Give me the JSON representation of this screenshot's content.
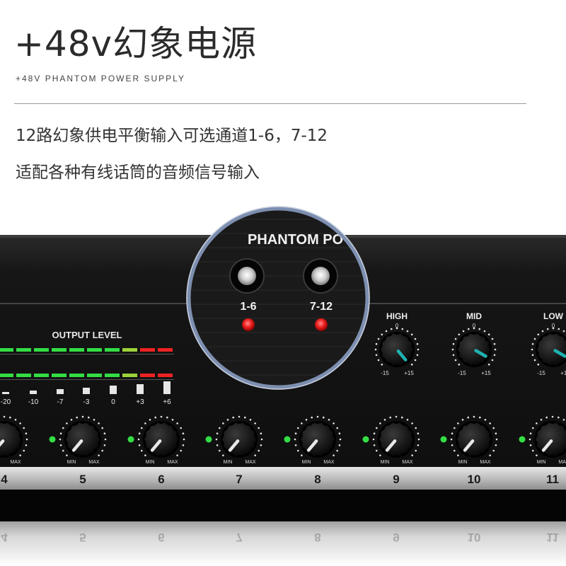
{
  "header": {
    "title": "+48v幻象电源",
    "subtitle": "+48V PHANTOM POWER SUPPLY"
  },
  "description": {
    "line1": "12路幻象供电平衡输入可选通道1-6，7-12",
    "line2": "适配各种有线话筒的音频信号输入"
  },
  "panel": {
    "output_level_label": "OUTPUT LEVEL",
    "meter_scale": [
      "-20",
      "-10",
      "-7",
      "-3",
      "0",
      "+3",
      "+6"
    ],
    "eq": [
      {
        "label": "HIGH",
        "center": "0",
        "min": "-15",
        "max": "+15"
      },
      {
        "label": "MID",
        "center": "0",
        "min": "-15",
        "max": "+15"
      },
      {
        "label": "LOW",
        "center": "0",
        "min": "-15",
        "max": "+15"
      }
    ],
    "knob_min": "MIN",
    "knob_max": "MAX",
    "channels": [
      "4",
      "5",
      "6",
      "7",
      "8",
      "9",
      "10",
      "11"
    ],
    "phantom": {
      "label": "PHANTOM PO",
      "buttons": [
        "1-6",
        "7-12"
      ]
    }
  },
  "colors": {
    "panel": "#141414",
    "led_green": "#33dd44",
    "led_red": "#ee2222",
    "knob_pointer": "#1fb2b2",
    "strip": "#c8c8c8"
  }
}
